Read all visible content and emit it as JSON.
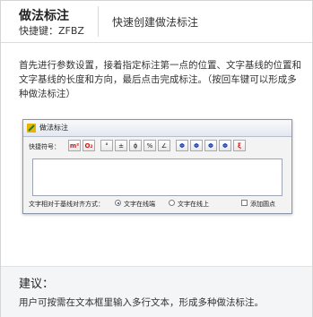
{
  "header": {
    "title": "做法标注",
    "shortcut": "快捷键：ZFBZ",
    "description": "快速创建做法标注"
  },
  "description": "首先进行参数设置，接着指定标注第一点的位置、文字基线的位置和文字基线的长度和方向，最后点击完成标注。（按回车键可以形成多种做法标注）",
  "dialog": {
    "title": "做法标注",
    "symbols_label": "快捷符号：",
    "symbols": [
      "m²",
      "O₂",
      "°",
      "±",
      "ϕ",
      "%",
      "∠",
      "Φ",
      "Φ",
      "Φ",
      "Φ",
      "ξ"
    ],
    "textarea_value": "",
    "align_label": "文字相对于基线对齐方式：",
    "options": [
      "文字在线端",
      "文字在线上"
    ],
    "selected_option": "文字在线端",
    "checkbox_label": "添加圆点",
    "checkbox_checked": false,
    "colors": {
      "title_bar": "#e3e8ef",
      "red_symbol": "#d01818",
      "blue_symbol": "#1a3fb8"
    }
  },
  "tip": {
    "title": "建议：",
    "body": "用户可按需在文本框里输入多行文本，形成多种做法标注。"
  }
}
